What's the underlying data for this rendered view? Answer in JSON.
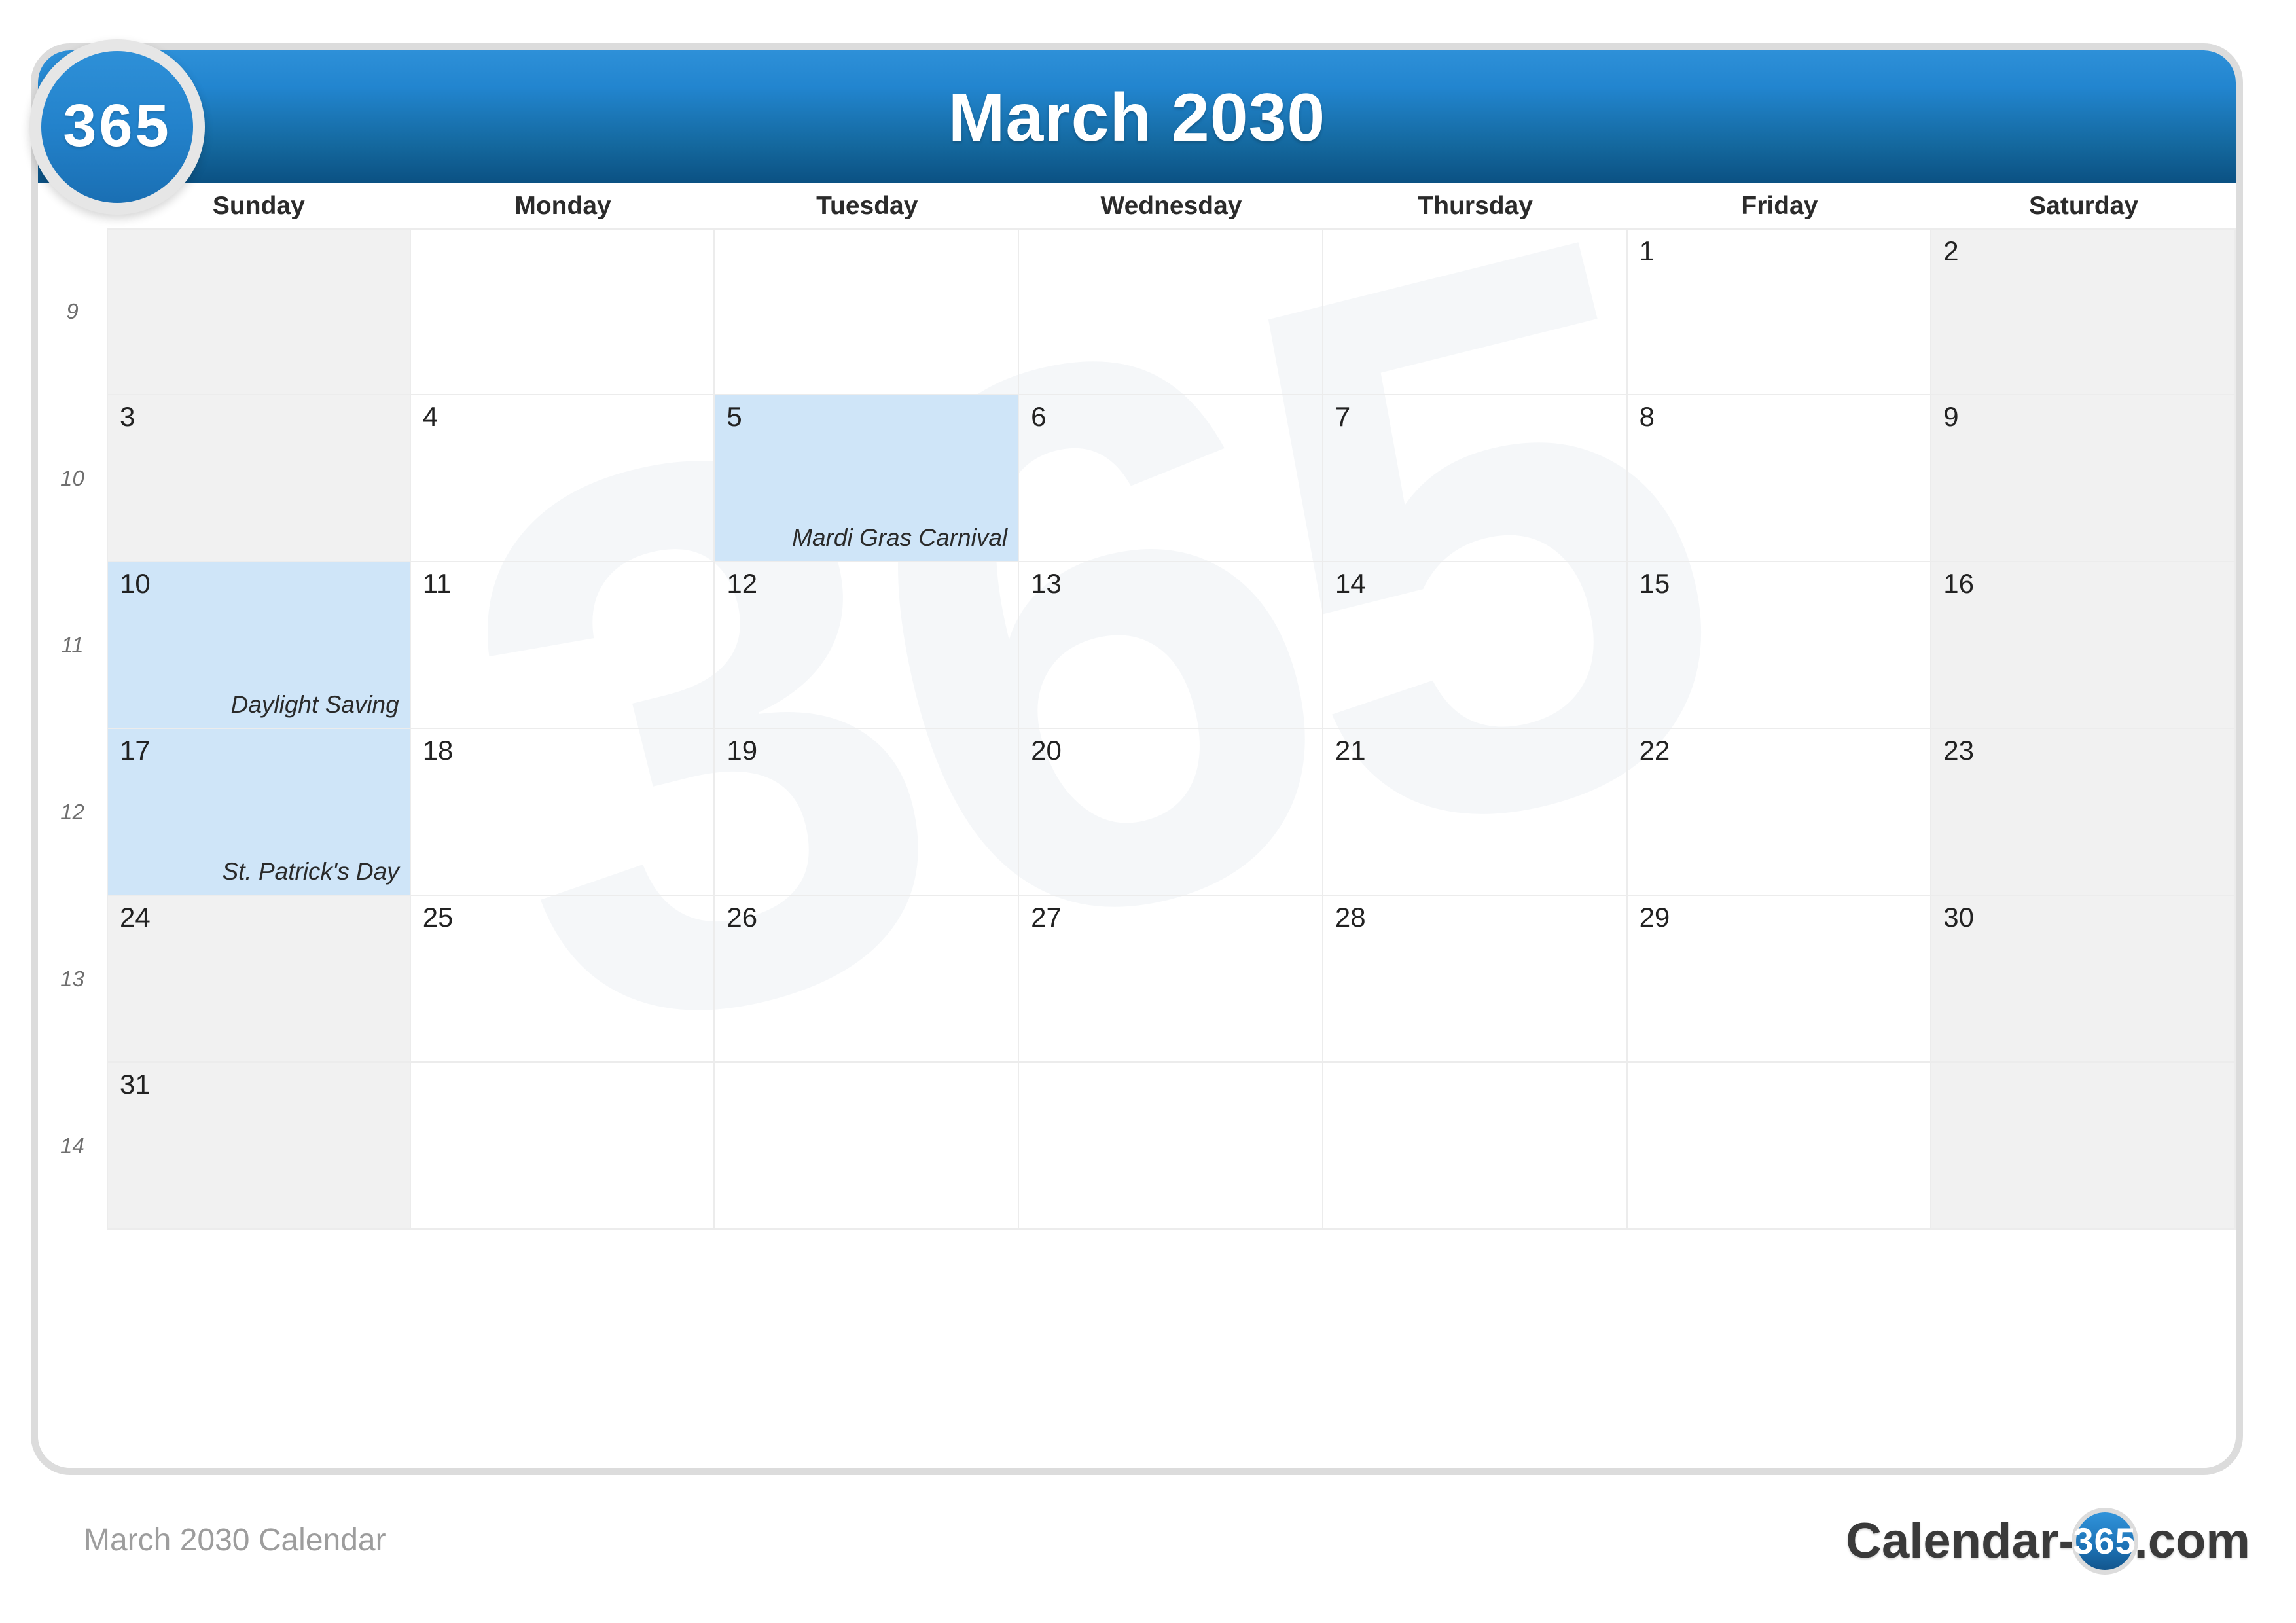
{
  "header": {
    "title": "March 2030",
    "badge_label": "365",
    "gradient_top": "#2e90d8",
    "gradient_bottom": "#0b5183"
  },
  "watermark": {
    "text": "365"
  },
  "weekday_headers": [
    "Sunday",
    "Monday",
    "Tuesday",
    "Wednesday",
    "Thursday",
    "Friday",
    "Saturday"
  ],
  "week_numbers": [
    "9",
    "10",
    "11",
    "12",
    "13",
    "14"
  ],
  "colors": {
    "event_cell": "#cfe5f8",
    "weekend_cell": "#f0f0f0",
    "grid_line": "#ececec",
    "card_border": "#dcdcdc",
    "accent_blue": "#1d72b5"
  },
  "weeks": [
    {
      "week": "9",
      "days": [
        {
          "num": "",
          "event": "",
          "weekend": true,
          "blank": true
        },
        {
          "num": "",
          "event": "",
          "weekend": false,
          "blank": true
        },
        {
          "num": "",
          "event": "",
          "weekend": false,
          "blank": true
        },
        {
          "num": "",
          "event": "",
          "weekend": false,
          "blank": true
        },
        {
          "num": "",
          "event": "",
          "weekend": false,
          "blank": true
        },
        {
          "num": "1",
          "event": "",
          "weekend": false,
          "blank": false
        },
        {
          "num": "2",
          "event": "",
          "weekend": true,
          "blank": false
        }
      ]
    },
    {
      "week": "10",
      "days": [
        {
          "num": "3",
          "event": "",
          "weekend": true,
          "blank": false
        },
        {
          "num": "4",
          "event": "",
          "weekend": false,
          "blank": false
        },
        {
          "num": "5",
          "event": "Mardi Gras Carnival",
          "weekend": false,
          "blank": false
        },
        {
          "num": "6",
          "event": "",
          "weekend": false,
          "blank": false
        },
        {
          "num": "7",
          "event": "",
          "weekend": false,
          "blank": false
        },
        {
          "num": "8",
          "event": "",
          "weekend": false,
          "blank": false
        },
        {
          "num": "9",
          "event": "",
          "weekend": true,
          "blank": false
        }
      ]
    },
    {
      "week": "11",
      "days": [
        {
          "num": "10",
          "event": "Daylight Saving",
          "weekend": true,
          "blank": false
        },
        {
          "num": "11",
          "event": "",
          "weekend": false,
          "blank": false
        },
        {
          "num": "12",
          "event": "",
          "weekend": false,
          "blank": false
        },
        {
          "num": "13",
          "event": "",
          "weekend": false,
          "blank": false
        },
        {
          "num": "14",
          "event": "",
          "weekend": false,
          "blank": false
        },
        {
          "num": "15",
          "event": "",
          "weekend": false,
          "blank": false
        },
        {
          "num": "16",
          "event": "",
          "weekend": true,
          "blank": false
        }
      ]
    },
    {
      "week": "12",
      "days": [
        {
          "num": "17",
          "event": "St. Patrick's Day",
          "weekend": true,
          "blank": false
        },
        {
          "num": "18",
          "event": "",
          "weekend": false,
          "blank": false
        },
        {
          "num": "19",
          "event": "",
          "weekend": false,
          "blank": false
        },
        {
          "num": "20",
          "event": "",
          "weekend": false,
          "blank": false
        },
        {
          "num": "21",
          "event": "",
          "weekend": false,
          "blank": false
        },
        {
          "num": "22",
          "event": "",
          "weekend": false,
          "blank": false
        },
        {
          "num": "23",
          "event": "",
          "weekend": true,
          "blank": false
        }
      ]
    },
    {
      "week": "13",
      "days": [
        {
          "num": "24",
          "event": "",
          "weekend": true,
          "blank": false
        },
        {
          "num": "25",
          "event": "",
          "weekend": false,
          "blank": false
        },
        {
          "num": "26",
          "event": "",
          "weekend": false,
          "blank": false
        },
        {
          "num": "27",
          "event": "",
          "weekend": false,
          "blank": false
        },
        {
          "num": "28",
          "event": "",
          "weekend": false,
          "blank": false
        },
        {
          "num": "29",
          "event": "",
          "weekend": false,
          "blank": false
        },
        {
          "num": "30",
          "event": "",
          "weekend": true,
          "blank": false
        }
      ]
    },
    {
      "week": "14",
      "days": [
        {
          "num": "31",
          "event": "",
          "weekend": true,
          "blank": false
        },
        {
          "num": "",
          "event": "",
          "weekend": false,
          "blank": true
        },
        {
          "num": "",
          "event": "",
          "weekend": false,
          "blank": true
        },
        {
          "num": "",
          "event": "",
          "weekend": false,
          "blank": true
        },
        {
          "num": "",
          "event": "",
          "weekend": false,
          "blank": true
        },
        {
          "num": "",
          "event": "",
          "weekend": false,
          "blank": true
        },
        {
          "num": "",
          "event": "",
          "weekend": true,
          "blank": true
        }
      ]
    }
  ],
  "footer": {
    "caption": "March 2030 Calendar",
    "logo_prefix": "Calendar-",
    "logo_badge": "365",
    "logo_suffix": ".com"
  }
}
